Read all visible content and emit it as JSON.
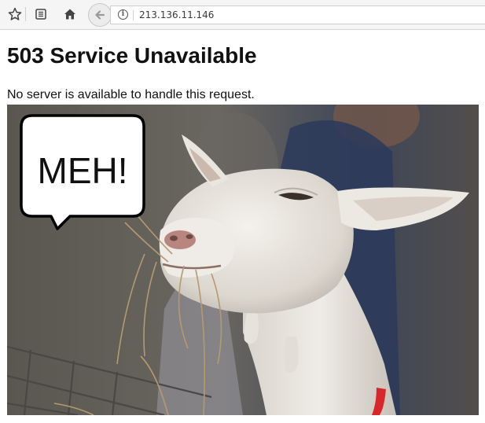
{
  "browser": {
    "bookmark_icon": "star-icon",
    "reader_icon": "reader-view-icon",
    "home_icon": "home-icon",
    "back_icon": "back-arrow-icon",
    "info_glyph": "i",
    "url": "213.136.11.146"
  },
  "page": {
    "heading": "503 Service Unavailable",
    "message": "No server is available to handle this request."
  },
  "image": {
    "speech_bubble_text": "MEH!"
  }
}
